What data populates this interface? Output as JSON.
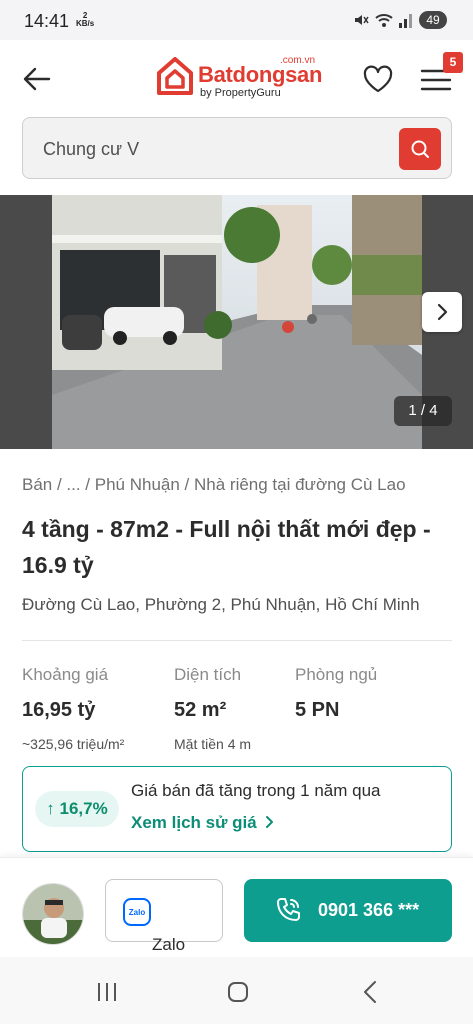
{
  "status_bar": {
    "time": "14:41",
    "speed_value": "2",
    "speed_unit": "KB/s",
    "battery": "49"
  },
  "header": {
    "logo_word": "Batdongsan",
    "logo_tld": ".com.vn",
    "logo_sub": "by PropertyGuru",
    "menu_badge": "5",
    "brand_color": "#e03c31"
  },
  "search": {
    "value": "Chung cư V"
  },
  "gallery": {
    "counter": "1 / 4"
  },
  "listing": {
    "breadcrumb": "Bán / ... / Phú Nhuận / Nhà riêng tại đường Cù Lao",
    "title": "4 tầng - 87m2 - Full nội thất mới đẹp - 16.9 tỷ",
    "address": "Đường Cù Lao, Phường 2, Phú Nhuận, Hồ Chí Minh",
    "specs": [
      {
        "label": "Khoảng giá",
        "value": "16,95 tỷ",
        "sub": "~325,96 triệu/m²"
      },
      {
        "label": "Diện tích",
        "value": "52 m²",
        "sub": "Mặt tiền 4 m"
      },
      {
        "label": "Phòng ngủ",
        "value": "5 PN",
        "sub": ""
      }
    ]
  },
  "price_trend": {
    "badge": "↑ 16,7%",
    "text": "Giá bán đã tăng trong 1 năm qua",
    "link": "Xem lịch sử giá",
    "accent_color": "#0d9e8f"
  },
  "contact": {
    "zalo_label": "Zalo",
    "phone": "0901 366 ***"
  },
  "icons": {
    "back": "arrow-left-icon",
    "favorite": "heart-icon",
    "menu": "hamburger-icon",
    "search": "search-icon",
    "next": "chevron-right-icon",
    "link_chevron": "chevron-right-icon",
    "zalo": "zalo-icon",
    "call": "phone-icon"
  }
}
